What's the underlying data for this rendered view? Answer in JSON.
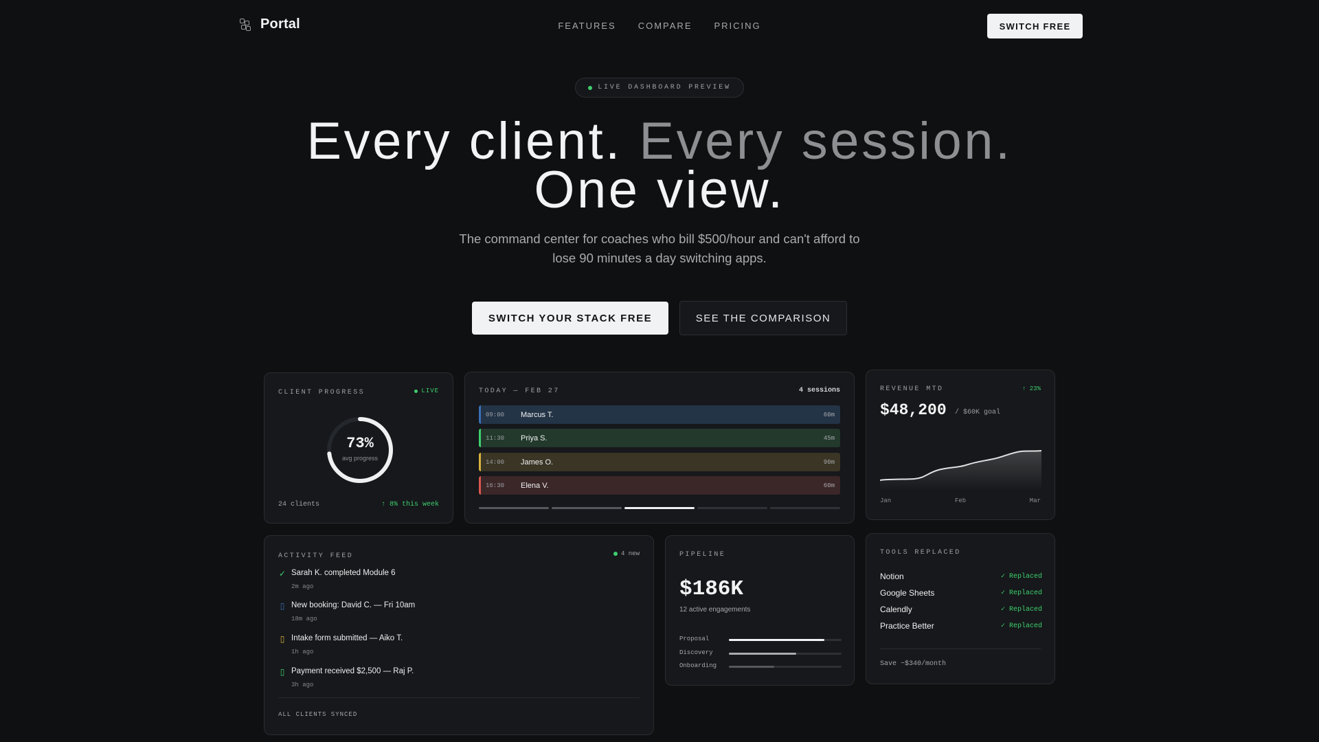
{
  "nav": {
    "brand": "Portal",
    "links": [
      "FEATURES",
      "COMPARE",
      "PRICING"
    ],
    "cta": "SWITCH FREE"
  },
  "hero": {
    "badge": "LIVE DASHBOARD PREVIEW",
    "headline_a": "Every client. ",
    "headline_b": "Every session.",
    "headline_c": "One view.",
    "subhead": "The command center for coaches who bill $500/hour and can't afford to lose 90 minutes a day switching apps.",
    "primary_cta": "SWITCH YOUR STACK FREE",
    "secondary_cta": "SEE THE COMPARISON"
  },
  "client_progress": {
    "title": "CLIENT PROGRESS",
    "badge": "LIVE",
    "percent_label": "73%",
    "percent_value": 0.73,
    "sub": "avg progress",
    "clients": "24 clients",
    "delta": "↑ 8% this week"
  },
  "today": {
    "title": "TODAY — FEB 27",
    "count": "4 sessions",
    "sessions": [
      {
        "time": "09:00",
        "name": "Marcus T.",
        "duration": "60m",
        "bar": "#3a6fb5",
        "bg": "#243447"
      },
      {
        "time": "11:30",
        "name": "Priya S.",
        "duration": "45m",
        "bar": "#3ecf6e",
        "bg": "#22392c"
      },
      {
        "time": "14:00",
        "name": "James O.",
        "duration": "90m",
        "bar": "#d9b23f",
        "bg": "#3a3525"
      },
      {
        "time": "16:30",
        "name": "Elena V.",
        "duration": "60m",
        "bar": "#d9574f",
        "bg": "#3b2628"
      }
    ],
    "active_step": 3,
    "steps": 5
  },
  "revenue": {
    "title": "REVENUE MTD",
    "delta": "↑ 23%",
    "amount": "$48,200",
    "goal": "/ $60K goal",
    "axis": [
      "Jan",
      "Feb",
      "Mar"
    ]
  },
  "activity": {
    "title": "ACTIVITY FEED",
    "new_label": "4 new",
    "items": [
      {
        "icon": "check-icon",
        "glyph": "✓",
        "color": "#3ecf6e",
        "text": "Sarah K. completed Module 6",
        "time": "2m ago"
      },
      {
        "icon": "calendar-icon",
        "glyph": "▯",
        "color": "#3a6fb5",
        "text": "New booking: David C. — Fri 10am",
        "time": "18m ago"
      },
      {
        "icon": "form-icon",
        "glyph": "▯",
        "color": "#d9b23f",
        "text": "Intake form submitted — Aiko T.",
        "time": "1h ago"
      },
      {
        "icon": "payment-icon",
        "glyph": "▯",
        "color": "#3ecf6e",
        "text": "Payment received $2,500 — Raj P.",
        "time": "3h ago"
      }
    ],
    "footer": "ALL CLIENTS SYNCED"
  },
  "pipeline": {
    "title": "PIPELINE",
    "amount": "$186K",
    "sub": "12 active engagements",
    "stages": [
      {
        "label": "Proposal",
        "value": 0.85,
        "color": "#f1f2f3"
      },
      {
        "label": "Discovery",
        "value": 0.6,
        "color": "#a9abae"
      },
      {
        "label": "Onboarding",
        "value": 0.4,
        "color": "#55585c"
      }
    ]
  },
  "tools": {
    "title": "TOOLS REPLACED",
    "items": [
      {
        "name": "Notion",
        "status": "✓ Replaced"
      },
      {
        "name": "Google Sheets",
        "status": "✓ Replaced"
      },
      {
        "name": "Calendly",
        "status": "✓ Replaced"
      },
      {
        "name": "Practice Better",
        "status": "✓ Replaced"
      }
    ],
    "footer": "Save ~$340/month"
  }
}
